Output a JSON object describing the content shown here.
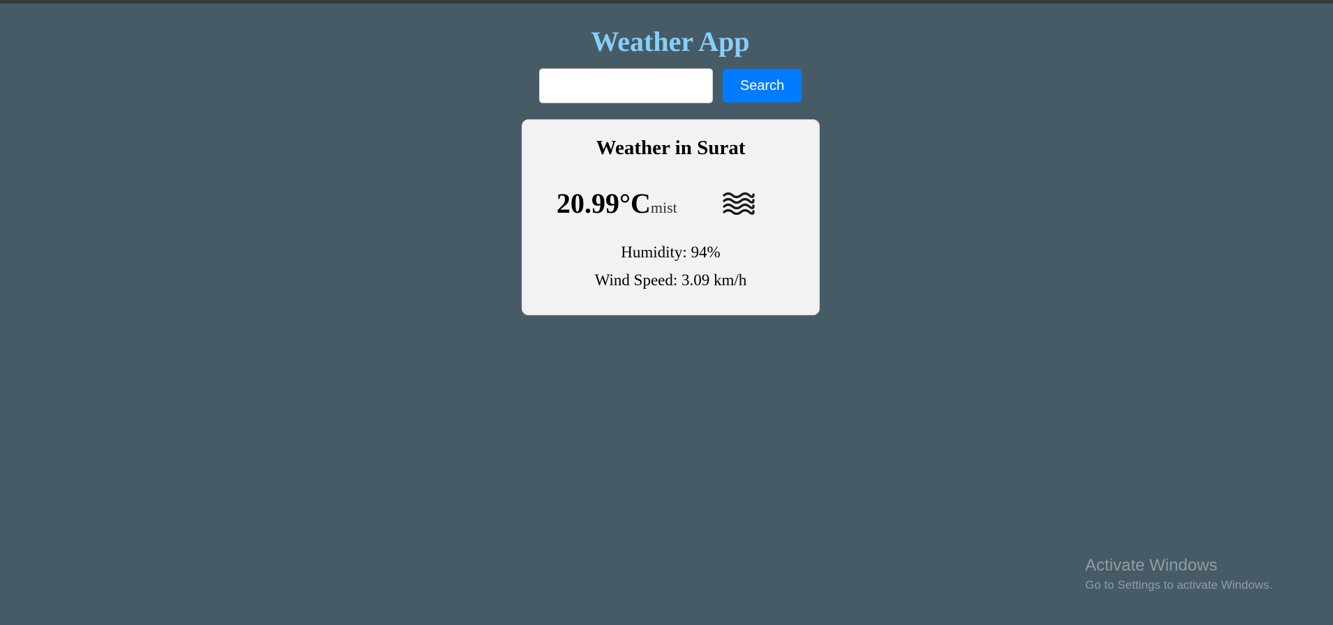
{
  "app": {
    "title": "Weather App"
  },
  "search": {
    "value": "",
    "placeholder": "",
    "button_label": "Search"
  },
  "weather": {
    "heading": "Weather in Surat",
    "temperature": "20.99°C",
    "condition": "mist",
    "icon": "mist-icon",
    "humidity": "Humidity: 94%",
    "wind_speed": "Wind Speed: 3.09 km/h"
  },
  "watermark": {
    "title": "Activate Windows",
    "subtitle": "Go to Settings to activate Windows."
  },
  "colors": {
    "background": "#465b66",
    "title": "#87cefa",
    "button": "#007bff",
    "card": "#f2f2f2"
  }
}
